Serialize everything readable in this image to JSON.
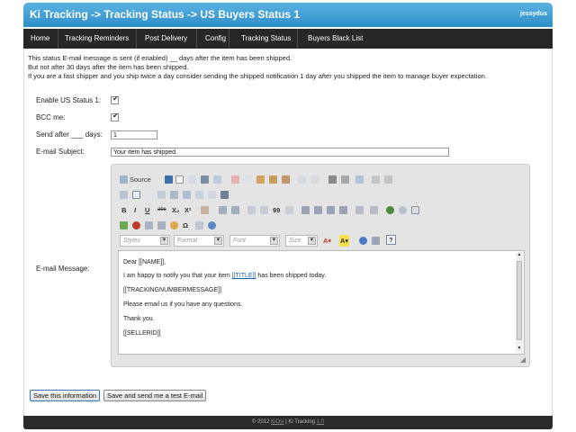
{
  "header": {
    "title": "Ki Tracking -> Tracking Status -> US Buyers Status 1",
    "user": "jessydus"
  },
  "nav": {
    "items": [
      "Home",
      "Tracking Reminders",
      "Post Delivery",
      "Config",
      "Tracking Status",
      "Buyers Black List"
    ]
  },
  "intro": {
    "line1": "This status E-mail message is sent (if enabled) __ days after the item has been shipped.",
    "line2": "But not after 30 days after the item has been shipped.",
    "line3": "If you are a fast shipper and you ship twice a day consider sending the shipped notification 1 day after you shipped the item to manage buyer expectation."
  },
  "form": {
    "enable_label": "Enable US Status 1:",
    "enable_checked": true,
    "bcc_label": "BCC me:",
    "bcc_checked": true,
    "send_after_label": "Send after ___ days:",
    "send_after_value": "1",
    "subject_label": "E-mail Subject:",
    "subject_value": "Your item has shipped.",
    "message_label": "E-mail Message:"
  },
  "editor": {
    "source_label": "Source",
    "styles_placeholder": "Styles",
    "format_placeholder": "Format",
    "font_placeholder": "Font",
    "size_placeholder": "Size",
    "content": {
      "greeting": "Dear [[NAME]],",
      "body_before": "I am happy to notify you that your item ",
      "title_token": "[[TITLE]]",
      "body_after": " has been shipped today.",
      "tracking_token": "[[TRACKINGNUMBERMESSAGE]]",
      "questions": "Please email us if you have any questions.",
      "thanks": "Thank you.",
      "seller_token": "[[SELLERID]]"
    }
  },
  "buttons": {
    "save": "Save this information",
    "save_test": "Save and send me a test E-mail"
  },
  "footer": {
    "copy_prefix": "© 2012 ",
    "brand": "KiOsi",
    "middle": " | Ki Tracking ",
    "version": "1.0"
  }
}
